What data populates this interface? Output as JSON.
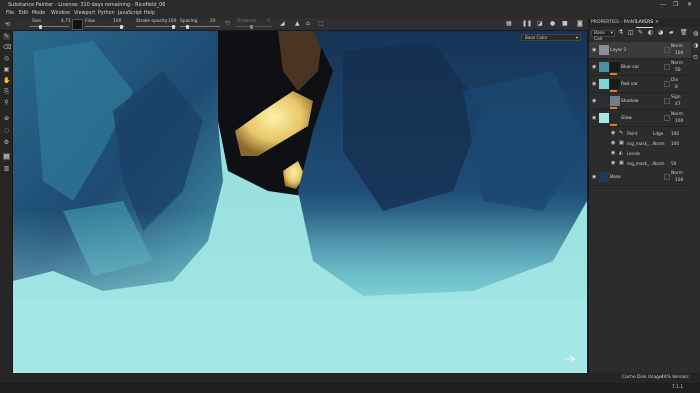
{
  "window": {
    "title": "Substance Painter - License: 310 days remaining - Ricefield_06",
    "minimize": "—",
    "maximize": "❐",
    "close": "✕"
  },
  "menu": [
    "File",
    "Edit",
    "Mode",
    "Window",
    "Viewport",
    "Python",
    "JavaScript",
    "Help"
  ],
  "tool_options": {
    "size_label": "Size",
    "size_value": "4.71",
    "flow_label": "Flow",
    "flow_value": "100",
    "stroke_opacity_label": "Stroke opacity",
    "stroke_opacity_value": "100",
    "spacing_label": "Spacing",
    "spacing_value": "20",
    "distance_label": "Distance",
    "distance_value": "0"
  },
  "viewport": {
    "channel_label": "Base Color"
  },
  "panel": {
    "properties_tab": "PROPERTIES - PAINT",
    "layers_tab": "LAYERS",
    "channel_select": "Base Colr",
    "layers": [
      {
        "name": "Layer 1",
        "blend": "Norm",
        "opacity": "100",
        "color": "#8a8f93",
        "selected": true
      },
      {
        "name": "Blue var",
        "blend": "Norm",
        "opacity": "50",
        "color": "#1a1a1a",
        "selected": false
      },
      {
        "name": "Red var",
        "blend": "Div",
        "opacity": "8",
        "color": "#7fd6d6",
        "selected": false
      },
      {
        "name": "Shadow",
        "blend": "Sign",
        "opacity": "47",
        "color": "#3a5a78",
        "selected": false
      },
      {
        "name": "Glow",
        "blend": "Norm",
        "opacity": "100",
        "color": "#a8e6e6",
        "selected": false
      }
    ],
    "effects": [
      {
        "name": "Paint",
        "blend": "Ldge",
        "opacity": "100",
        "icon": "brush-icon"
      },
      {
        "name": "mg_mask_...",
        "blend": "Norm",
        "opacity": "100",
        "icon": "mask-icon"
      },
      {
        "name": "Levels",
        "blend": "",
        "opacity": "",
        "icon": "levels-icon"
      },
      {
        "name": "mg_mask_...",
        "blend": "Norm",
        "opacity": "50",
        "icon": "mask-icon"
      }
    ],
    "base_layer": {
      "name": "Base",
      "blend": "Norm",
      "opacity": "100"
    }
  },
  "status": {
    "cache": "Cache Disk Usage:",
    "cache_value": "44%",
    "version": "Version: 7.1.1"
  },
  "colors": {
    "brush_accent": "#e07c2c",
    "water": "#9ee3e3",
    "rock_dark": "#173152"
  }
}
